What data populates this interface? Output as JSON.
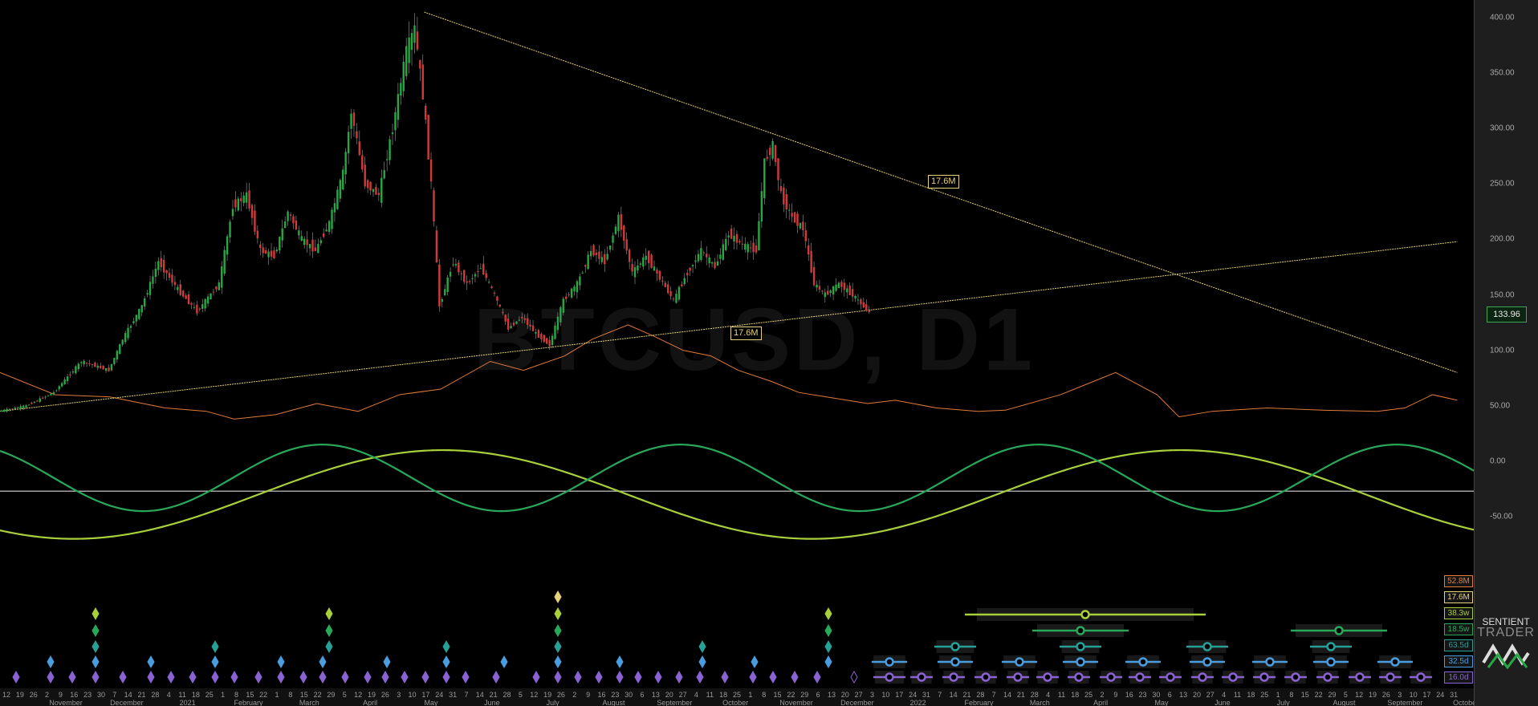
{
  "watermark": "BTCUSD, D1",
  "y_axis": {
    "ticks": [
      {
        "value": 400,
        "label": "400.00"
      },
      {
        "value": 350,
        "label": "350.00"
      },
      {
        "value": 300,
        "label": "300.00"
      },
      {
        "value": 250,
        "label": "250.00"
      },
      {
        "value": 200,
        "label": "200.00"
      },
      {
        "value": 150,
        "label": "150.00"
      },
      {
        "value": 100,
        "label": "100.00"
      },
      {
        "value": 50,
        "label": "50.00"
      },
      {
        "value": 0,
        "label": "0.00"
      },
      {
        "value": -50,
        "label": "-50.00"
      }
    ]
  },
  "current_price": "133.96",
  "annotations": {
    "upper": "17.6M",
    "lower": "17.6M"
  },
  "legend": [
    {
      "label": "52.8M",
      "color": "#e07b39"
    },
    {
      "label": "17.6M",
      "color": "#e6d27a"
    },
    {
      "label": "38.3w",
      "color": "#a8cf3c"
    },
    {
      "label": "18.5w",
      "color": "#2aa85a"
    },
    {
      "label": "63.5d",
      "color": "#27a098"
    },
    {
      "label": "32.5d",
      "color": "#4a9ee0"
    },
    {
      "label": "16.0d",
      "color": "#8a63d2"
    }
  ],
  "brand": {
    "line1": "SENTIENT",
    "line2": "TRADER"
  },
  "x_axis": {
    "day_labels": [
      "12",
      "19",
      "26",
      "2",
      "9",
      "16",
      "23",
      "30",
      "7",
      "14",
      "21",
      "28",
      "4",
      "11",
      "18",
      "25",
      "1",
      "8",
      "15",
      "22",
      "1",
      "8",
      "15",
      "22",
      "29",
      "5",
      "12",
      "19",
      "26",
      "3",
      "10",
      "17",
      "24",
      "31",
      "7",
      "14",
      "21",
      "28",
      "5",
      "12",
      "19",
      "26",
      "2",
      "9",
      "16",
      "23",
      "30",
      "6",
      "13",
      "20",
      "27",
      "4",
      "11",
      "18",
      "25",
      "1",
      "8",
      "15",
      "22",
      "29",
      "6",
      "13",
      "20",
      "27",
      "3",
      "10",
      "17",
      "24",
      "31",
      "7",
      "14",
      "21",
      "28",
      "7",
      "14",
      "21",
      "28",
      "4",
      "11",
      "18",
      "25",
      "2",
      "9",
      "16",
      "23",
      "30",
      "6",
      "13",
      "20",
      "27",
      "4",
      "11",
      "18",
      "25",
      "1",
      "8",
      "15",
      "22",
      "29",
      "5",
      "12",
      "19",
      "26",
      "3",
      "10",
      "17",
      "24",
      "31"
    ],
    "month_labels": [
      "November",
      "December",
      "2021",
      "February",
      "March",
      "April",
      "May",
      "June",
      "July",
      "August",
      "September",
      "October",
      "November",
      "December",
      "2022",
      "February",
      "March",
      "April",
      "May",
      "June",
      "July",
      "August",
      "September",
      "October"
    ]
  },
  "colors": {
    "bull": "#27a844",
    "bear": "#d23a3a",
    "trendline": "#e6d27a",
    "orange_line": "#e07b39",
    "wave_light": "#a8cf3c",
    "wave_dark": "#2aa85a",
    "zero_line": "#d8d8d8"
  },
  "chart_data": {
    "type": "line",
    "title": "BTCUSD, D1",
    "ylim": [
      -60,
      410
    ],
    "grid": false,
    "price_path": [
      [
        0,
        45
      ],
      [
        10,
        50
      ],
      [
        20,
        62
      ],
      [
        30,
        90
      ],
      [
        40,
        82
      ],
      [
        45,
        110
      ],
      [
        52,
        140
      ],
      [
        58,
        180
      ],
      [
        65,
        155
      ],
      [
        72,
        135
      ],
      [
        80,
        160
      ],
      [
        85,
        230
      ],
      [
        90,
        240
      ],
      [
        95,
        190
      ],
      [
        100,
        185
      ],
      [
        105,
        225
      ],
      [
        110,
        200
      ],
      [
        115,
        190
      ],
      [
        120,
        215
      ],
      [
        125,
        260
      ],
      [
        128,
        315
      ],
      [
        133,
        250
      ],
      [
        138,
        240
      ],
      [
        143,
        300
      ],
      [
        148,
        370
      ],
      [
        151,
        390
      ],
      [
        154,
        330
      ],
      [
        157,
        250
      ],
      [
        160,
        140
      ],
      [
        165,
        180
      ],
      [
        170,
        160
      ],
      [
        175,
        175
      ],
      [
        180,
        150
      ],
      [
        185,
        120
      ],
      [
        190,
        130
      ],
      [
        195,
        115
      ],
      [
        200,
        105
      ],
      [
        205,
        145
      ],
      [
        210,
        160
      ],
      [
        215,
        190
      ],
      [
        220,
        180
      ],
      [
        225,
        220
      ],
      [
        230,
        170
      ],
      [
        235,
        185
      ],
      [
        240,
        165
      ],
      [
        245,
        145
      ],
      [
        250,
        170
      ],
      [
        255,
        190
      ],
      [
        260,
        175
      ],
      [
        265,
        205
      ],
      [
        270,
        195
      ],
      [
        275,
        190
      ],
      [
        278,
        270
      ],
      [
        281,
        285
      ],
      [
        284,
        240
      ],
      [
        288,
        220
      ],
      [
        292,
        210
      ],
      [
        296,
        160
      ],
      [
        300,
        150
      ],
      [
        305,
        160
      ],
      [
        310,
        150
      ],
      [
        316,
        134
      ]
    ],
    "support_line": {
      "x": [
        0,
        529
      ],
      "y": [
        45,
        198
      ]
    },
    "resistance_line": {
      "x": [
        154,
        529
      ],
      "y": [
        405,
        80
      ]
    },
    "orange_series": [
      [
        0,
        80
      ],
      [
        20,
        60
      ],
      [
        40,
        58
      ],
      [
        60,
        48
      ],
      [
        75,
        45
      ],
      [
        85,
        38
      ],
      [
        100,
        42
      ],
      [
        115,
        52
      ],
      [
        130,
        45
      ],
      [
        145,
        60
      ],
      [
        160,
        65
      ],
      [
        178,
        90
      ],
      [
        190,
        82
      ],
      [
        205,
        95
      ],
      [
        215,
        110
      ],
      [
        228,
        123
      ],
      [
        238,
        112
      ],
      [
        248,
        100
      ],
      [
        258,
        95
      ],
      [
        268,
        82
      ],
      [
        280,
        72
      ],
      [
        290,
        62
      ],
      [
        300,
        58
      ],
      [
        315,
        52
      ],
      [
        325,
        55
      ],
      [
        340,
        48
      ],
      [
        355,
        45
      ],
      [
        365,
        46
      ],
      [
        385,
        60
      ],
      [
        395,
        70
      ],
      [
        405,
        80
      ],
      [
        420,
        60
      ],
      [
        428,
        40
      ],
      [
        440,
        45
      ],
      [
        460,
        48
      ],
      [
        480,
        46
      ],
      [
        500,
        45
      ],
      [
        510,
        48
      ],
      [
        520,
        60
      ],
      [
        529,
        55
      ]
    ],
    "waves": [
      {
        "name": "38.3w",
        "amplitude": 40,
        "offset": -30,
        "period": 268,
        "phase": -0.35
      },
      {
        "name": "18.5w",
        "amplitude": 30,
        "offset": -15,
        "period": 130,
        "phase": 0.35
      }
    ],
    "zero_line": -27,
    "x_range": [
      0,
      535
    ]
  }
}
